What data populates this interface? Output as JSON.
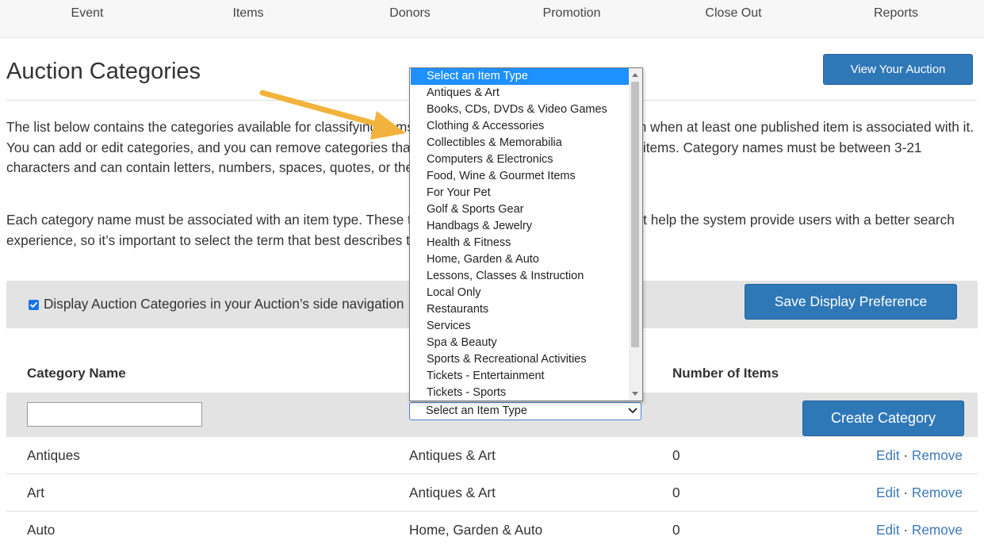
{
  "nav": {
    "items": [
      "Event",
      "Items",
      "Donors",
      "Promotion",
      "Close Out",
      "Reports"
    ]
  },
  "header": {
    "title": "Auction Categories",
    "view_auction_label": "View Your Auction"
  },
  "intro": {
    "paragraph1": "The list below contains the categories available for classifying items. A category will appear in your auction when at least one published item is associated with it. You can add or edit categories, and you can remove categories that are not currently associated with any items. Category names must be between 3-21 characters and can contain letters, numbers, spaces, quotes, or the following characters: / & _ . , ; : ! ( ) [ ]",
    "paragraph2": "Each category name must be associated with an item type. These types are not visible in your auction, but help the system provide users with a better search experience, so it’s important to select the term that best describes the category."
  },
  "display_pref": {
    "checked": true,
    "label": "Display Auction Categories in your Auction’s side navigation",
    "save_label": "Save Display Preference"
  },
  "table": {
    "headers": {
      "name": "Category Name",
      "count": "Number of Items"
    },
    "new_row": {
      "name_value": "",
      "type_value": "Select an Item Type",
      "create_label": "Create Category"
    },
    "rows": [
      {
        "name": "Antiques",
        "type": "Antiques & Art",
        "count": "0"
      },
      {
        "name": "Art",
        "type": "Antiques & Art",
        "count": "0"
      },
      {
        "name": "Auto",
        "type": "Home, Garden & Auto",
        "count": "0"
      }
    ],
    "edit_label": "Edit",
    "separator": "·",
    "remove_label": "Remove"
  },
  "dropdown": {
    "open": true,
    "selected_index": 0,
    "options": [
      "Select an Item Type",
      "Antiques & Art",
      "Books, CDs, DVDs & Video Games",
      "Clothing & Accessories",
      "Collectibles & Memorabilia",
      "Computers & Electronics",
      "Food, Wine & Gourmet Items",
      "For Your Pet",
      "Golf & Sports Gear",
      "Handbags & Jewelry",
      "Health & Fitness",
      "Home, Garden & Auto",
      "Lessons, Classes & Instruction",
      "Local Only",
      "Restaurants",
      "Services",
      "Spa & Beauty",
      "Sports & Recreational Activities",
      "Tickets - Entertainment",
      "Tickets - Sports"
    ]
  },
  "colors": {
    "primary_button": "#2f78b8",
    "link": "#3d7ab8",
    "highlight": "#1e90ff",
    "annotation_arrow": "#f2b33d",
    "band": "#e3e3e3"
  }
}
